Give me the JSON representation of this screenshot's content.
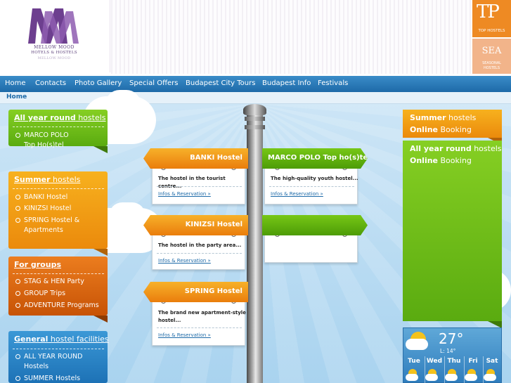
{
  "header": {
    "logo_monogram": "MM",
    "logo_line1": "MELLOW MOOD",
    "logo_line2": "HOTELS & HOSTELS",
    "logo_line3": "MELLOW MOOD",
    "top_badge": {
      "big": "TP",
      "small": "TOP HOSTELS"
    },
    "seasonal_badge": {
      "big": "SEA",
      "small1": "SEASONAL",
      "small2": "HOSTELS"
    }
  },
  "nav": {
    "items": [
      "Home",
      "Contacts",
      "Photo Gallery",
      "Special Offers",
      "Budapest City Tours",
      "Budapest Info",
      "Festivals"
    ]
  },
  "breadcrumb": "Home",
  "left": {
    "all_year": {
      "bold": "All year round",
      "rest": " hostels",
      "items": [
        "MARCO POLO",
        "Top Ho(s)tel"
      ]
    },
    "summer": {
      "bold": "Summer",
      "rest": " hostels",
      "items": [
        "BANKI Hostel",
        "KINIZSI Hostel",
        "SPRING Hostel &",
        "Apartments"
      ]
    },
    "groups": {
      "bold": "For groups",
      "items": [
        "STAG & HEN Party",
        "GROUP Trips",
        "ADVENTURE Programs"
      ]
    },
    "general": {
      "bold": "General",
      "rest": " hostel facilities",
      "items": [
        "ALL YEAR ROUND",
        "Hostels",
        "SUMMER Hostels"
      ]
    }
  },
  "signs": {
    "banki": {
      "title": "BANKI Hostel",
      "desc": "The hostel in the tourist centre...",
      "link": "Infos & Reservation »"
    },
    "marco": {
      "title": "MARCO POLO Top ho(s)tel",
      "desc": "The high-quality youth hostel...",
      "link": "Infos & Reservation »"
    },
    "kinizsi": {
      "title": "KINIZSI Hostel",
      "desc": "The hostel in the party area...",
      "link": "Infos & Reservation »"
    },
    "spring": {
      "title": "SPRING Hostel",
      "desc1": "The brand new apartment-style",
      "desc2": "hostel...",
      "link": "Infos & Reservation »"
    }
  },
  "right": {
    "summer_booking": {
      "b1": "Summer",
      "r1": " hostels",
      "b2": "Online",
      "r2": " Booking"
    },
    "allyear_booking": {
      "b1": "All year round",
      "r1": " hostels",
      "b2": "Online",
      "r2": " Booking"
    }
  },
  "weather": {
    "temp": "27°",
    "low": "L: 14°",
    "days": [
      "Tue",
      "Wed",
      "Thu",
      "Fri",
      "Sat"
    ]
  },
  "colors": {
    "nav": "#2a7cbd",
    "green": "#6bbd19",
    "orange": "#f2a013",
    "red": "#d9620e",
    "blue": "#2b85c8"
  }
}
